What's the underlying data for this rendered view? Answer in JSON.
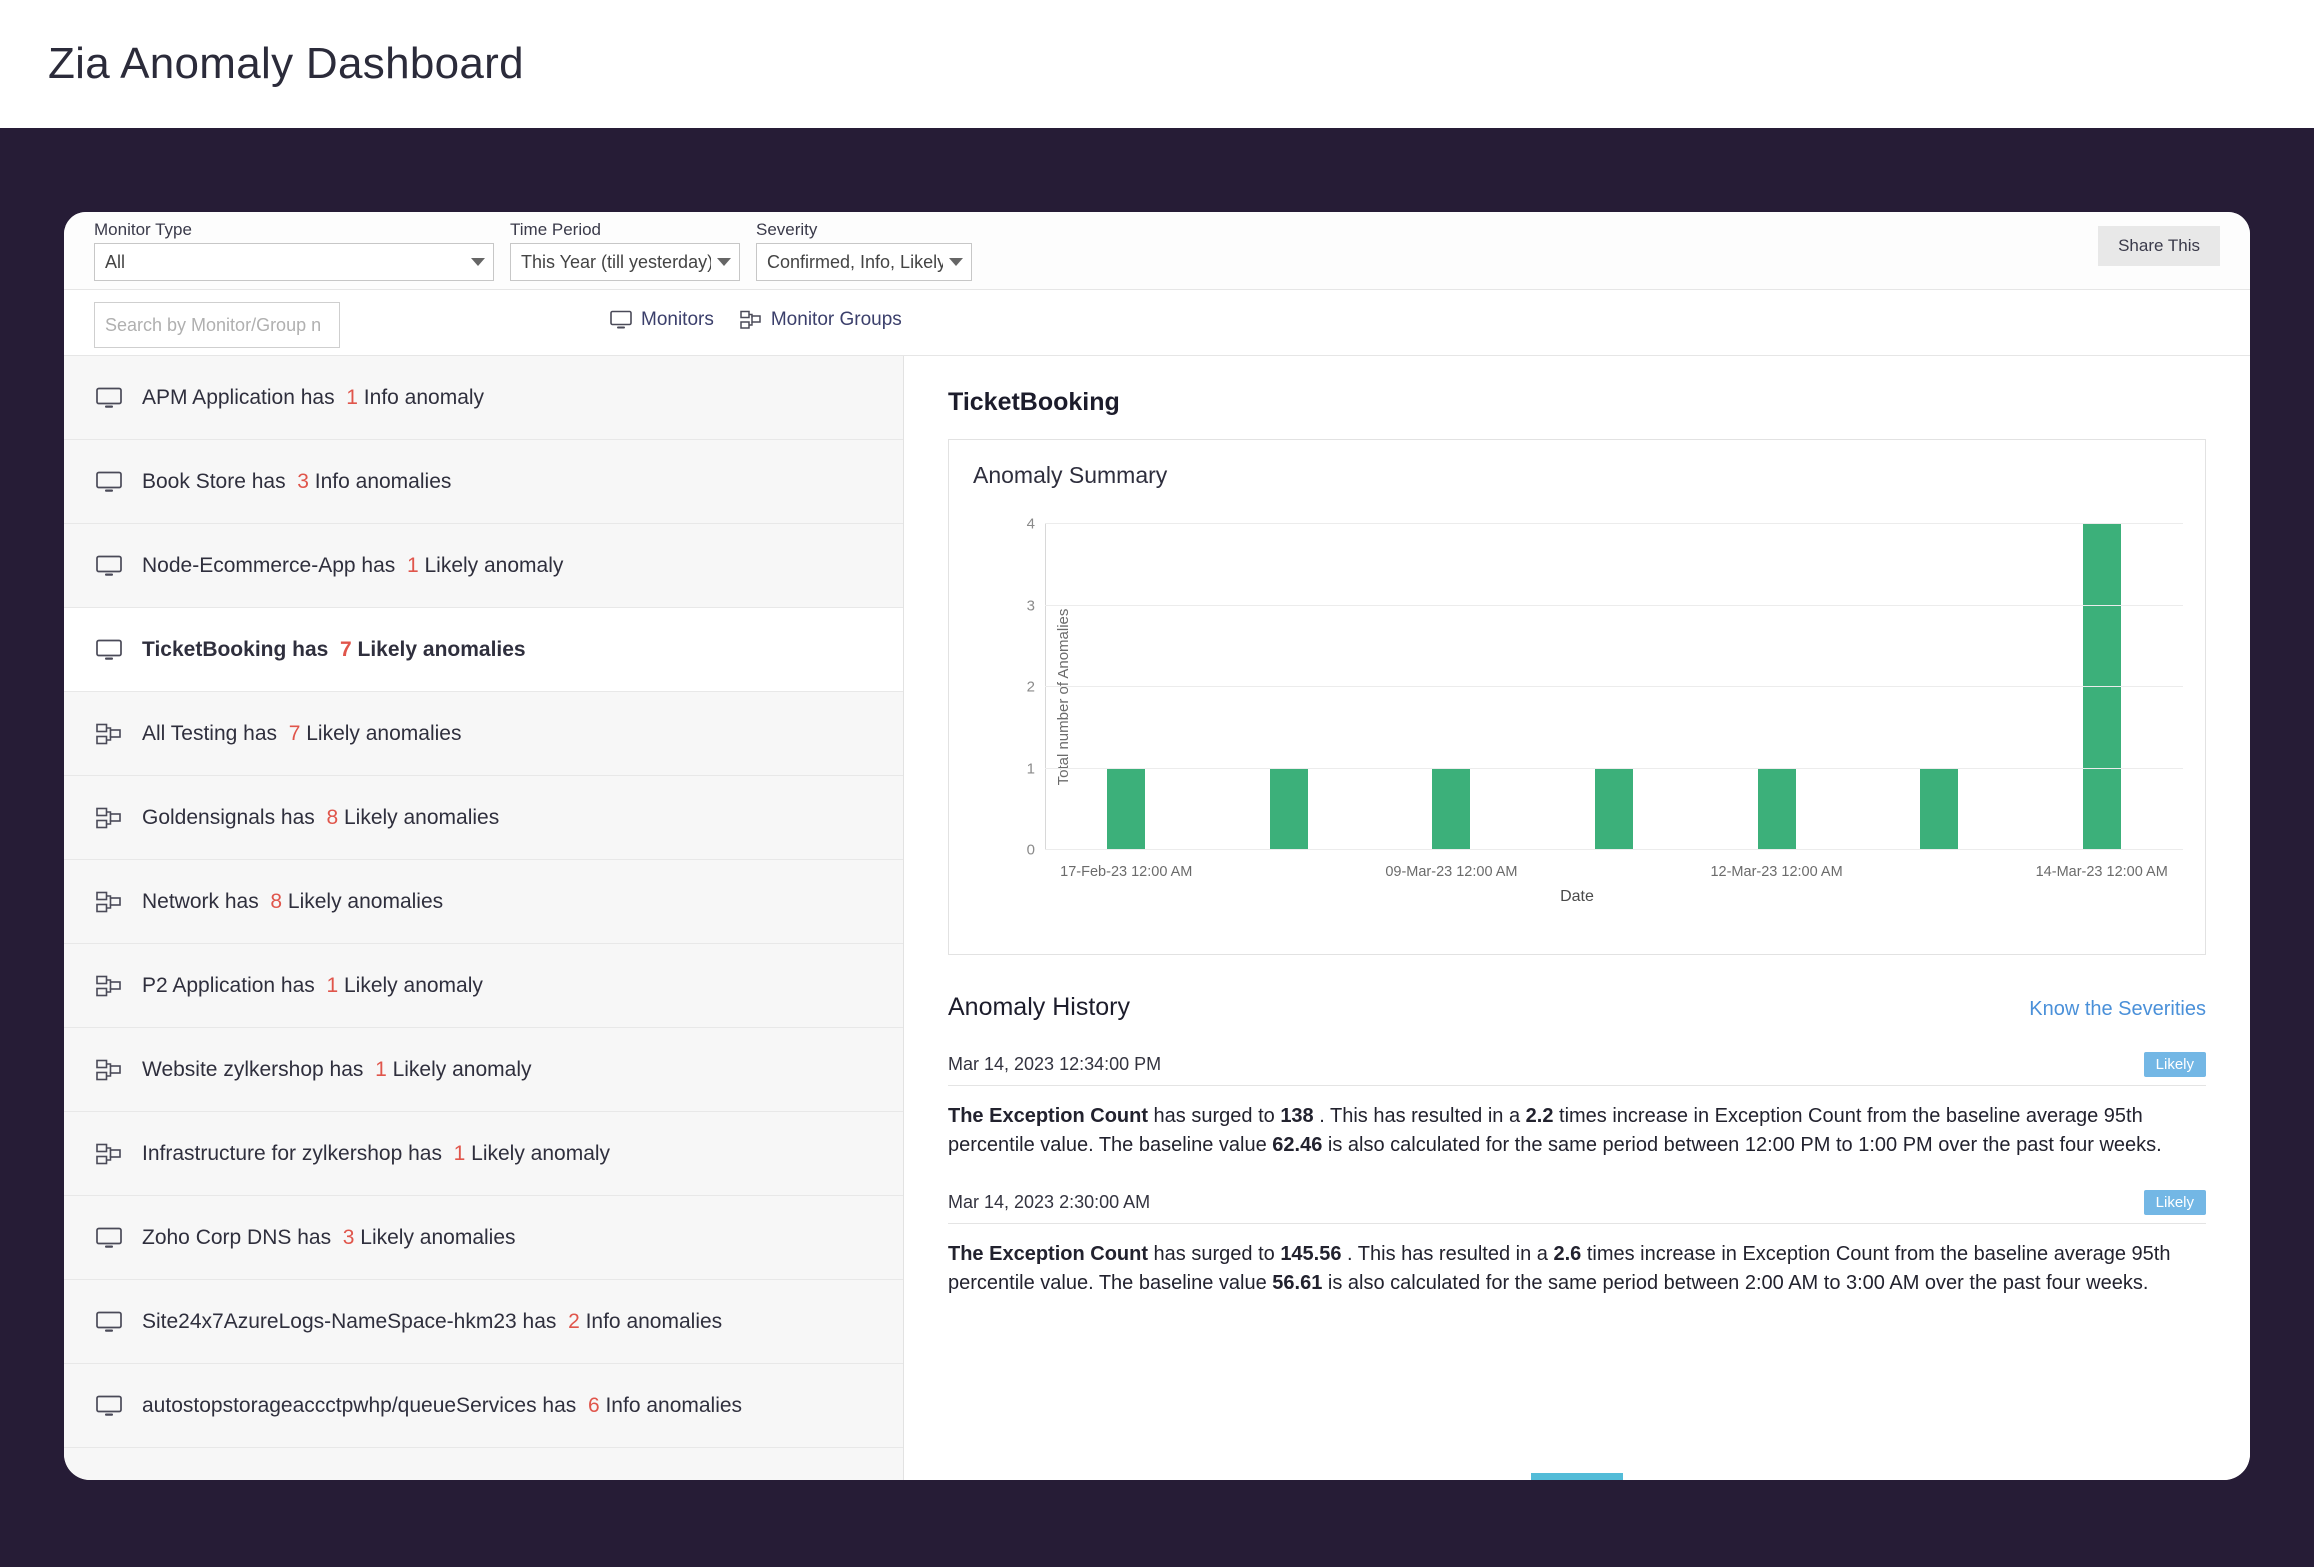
{
  "header": {
    "title": "Zia Anomaly Dashboard"
  },
  "filters": {
    "monitor_type": {
      "label": "Monitor Type",
      "value": "All"
    },
    "time_period": {
      "label": "Time Period",
      "value": "This Year (till yesterday)"
    },
    "severity": {
      "label": "Severity",
      "value": "Confirmed, Info, Likely"
    },
    "share_label": "Share This"
  },
  "search": {
    "placeholder": "Search by Monitor/Group n",
    "value": ""
  },
  "toggles": {
    "monitors": "Monitors",
    "monitor_groups": "Monitor Groups"
  },
  "monitor_list": [
    {
      "icon": "monitor-icon",
      "name": "APM Application",
      "has": "has",
      "count": "1",
      "severity_text": "Info anomaly",
      "selected": false
    },
    {
      "icon": "monitor-icon",
      "name": "Book Store",
      "has": "has",
      "count": "3",
      "severity_text": "Info anomalies",
      "selected": false
    },
    {
      "icon": "monitor-icon",
      "name": "Node-Ecommerce-App",
      "has": "has",
      "count": "1",
      "severity_text": "Likely anomaly",
      "selected": false
    },
    {
      "icon": "monitor-icon",
      "name": "TicketBooking",
      "has": "has",
      "count": "7",
      "severity_text": "Likely anomalies",
      "selected": true
    },
    {
      "icon": "monitor-group-icon",
      "name": "All Testing",
      "has": "has",
      "count": "7",
      "severity_text": "Likely anomalies",
      "selected": false
    },
    {
      "icon": "monitor-group-icon",
      "name": "Goldensignals",
      "has": "has",
      "count": "8",
      "severity_text": "Likely anomalies",
      "selected": false
    },
    {
      "icon": "monitor-group-icon",
      "name": "Network",
      "has": "has",
      "count": "8",
      "severity_text": "Likely anomalies",
      "selected": false
    },
    {
      "icon": "monitor-group-icon",
      "name": "P2 Application",
      "has": "has",
      "count": "1",
      "severity_text": "Likely anomaly",
      "selected": false
    },
    {
      "icon": "monitor-group-icon",
      "name": "Website zylkershop",
      "has": "has",
      "count": "1",
      "severity_text": "Likely anomaly",
      "selected": false
    },
    {
      "icon": "monitor-group-icon",
      "name": "Infrastructure for zylkershop",
      "has": "has",
      "count": "1",
      "severity_text": "Likely anomaly",
      "selected": false
    },
    {
      "icon": "monitor-icon",
      "name": "Zoho Corp DNS",
      "has": "has",
      "count": "3",
      "severity_text": "Likely anomalies",
      "selected": false
    },
    {
      "icon": "monitor-icon",
      "name": "Site24x7AzureLogs-NameSpace-hkm23",
      "has": "has",
      "count": "2",
      "severity_text": "Info anomalies",
      "selected": false
    },
    {
      "icon": "monitor-icon",
      "name": "autostopstorageaccctpwhp/queueServices",
      "has": "has",
      "count": "6",
      "severity_text": "Info anomalies",
      "selected": false
    }
  ],
  "detail": {
    "monitor_name": "TicketBooking",
    "chart_title": "Anomaly Summary",
    "history_title": "Anomaly History",
    "know_severities_link": "Know the Severities",
    "entries": [
      {
        "timestamp": "Mar 14, 2023 12:34:00 PM",
        "badge": "Likely",
        "description": "The Exception Count has surged to 138 . This has resulted in a 2.2 times increase in Exception Count from the baseline average 95th percentile value. The baseline value 62.46 is also calculated for the same period between 12:00 PM to 1:00 PM over the past four weeks."
      },
      {
        "timestamp": "Mar 14, 2023 2:30:00 AM",
        "badge": "Likely",
        "description": "The Exception Count has surged to 145.56 . This has resulted in a 2.6 times increase in Exception Count from the baseline average 95th percentile value. The baseline value 56.61 is also calculated for the same period between 2:00 AM to 3:00 AM over the past four weeks."
      }
    ]
  },
  "colors": {
    "bar_green": "#3cb07a",
    "count_red": "#e0554b",
    "badge_blue": "#73b7e5",
    "link_blue": "#4a90d9",
    "backdrop": "#261c36"
  },
  "chart_data": {
    "type": "bar",
    "title": "Anomaly Summary",
    "xlabel": "Date",
    "ylabel": "Total number of Anomalies",
    "ylim": [
      0,
      4
    ],
    "yticks": [
      0,
      1,
      2,
      3,
      4
    ],
    "gridlines": true,
    "legend": "none",
    "categories": [
      "17-Feb-23 12:00 AM",
      "",
      "09-Mar-23 12:00 AM",
      "",
      "12-Mar-23 12:00 AM",
      "",
      "14-Mar-23 12:00 AM"
    ],
    "visible_tick_labels": [
      "17-Feb-23 12:00 AM",
      "09-Mar-23 12:00 AM",
      "12-Mar-23 12:00 AM",
      "14-Mar-23 12:00 AM"
    ],
    "values": [
      1,
      1,
      1,
      1,
      1,
      1,
      4
    ],
    "series": [
      {
        "name": "Total number of Anomalies",
        "values": [
          1,
          1,
          1,
          1,
          1,
          1,
          4
        ],
        "color": "#3cb07a"
      }
    ]
  }
}
